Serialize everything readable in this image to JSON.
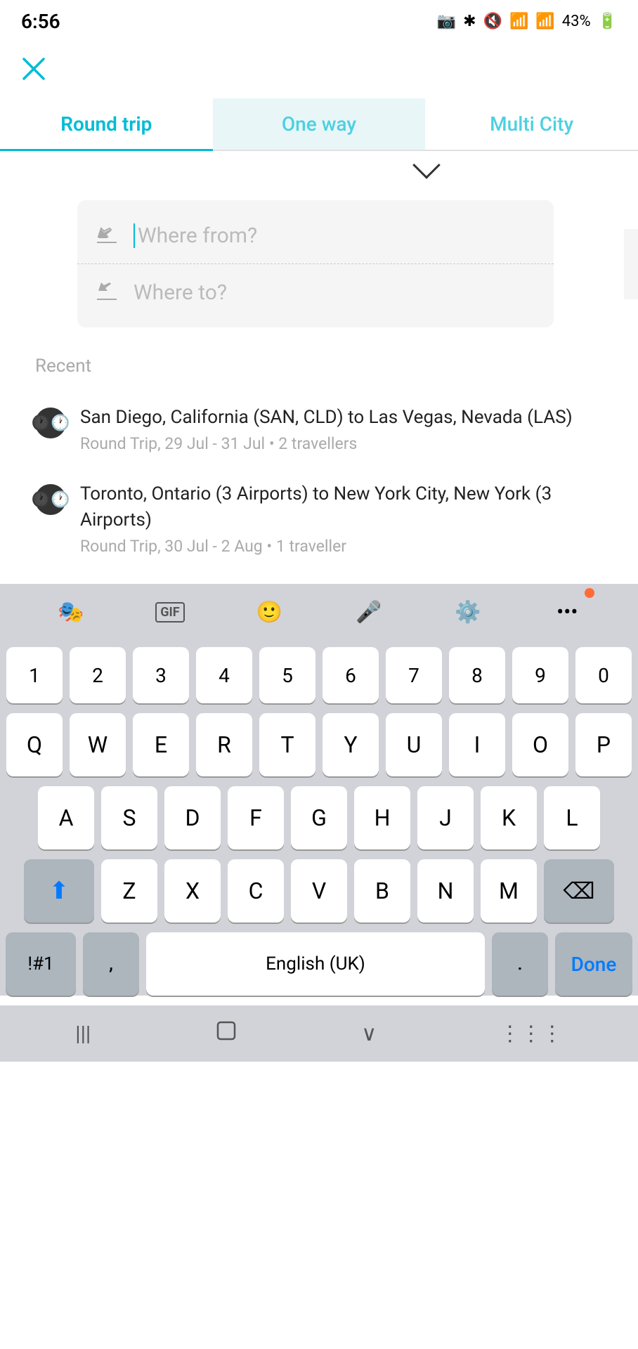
{
  "statusBar": {
    "time": "6:56",
    "battery": "43%"
  },
  "tabs": {
    "items": [
      {
        "id": "round-trip",
        "label": "Round trip",
        "active": true
      },
      {
        "id": "one-way",
        "label": "One way",
        "active": false
      },
      {
        "id": "multi-city",
        "label": "Multi City",
        "active": false
      }
    ]
  },
  "search": {
    "from_placeholder": "Where from?",
    "to_placeholder": "Where to?"
  },
  "recent": {
    "label": "Recent",
    "items": [
      {
        "route": "San Diego, California (SAN, CLD) to Las Vegas, Nevada (LAS)",
        "details": "Round Trip, 29 Jul - 31 Jul • 2 travellers"
      },
      {
        "route": "Toronto, Ontario (3 Airports) to New York City, New York (3 Airports)",
        "details": "Round Trip, 30 Jul - 2 Aug • 1 traveller"
      }
    ]
  },
  "keyboard": {
    "numbers": [
      "1",
      "2",
      "3",
      "4",
      "5",
      "6",
      "7",
      "8",
      "9",
      "0"
    ],
    "row1": [
      "Q",
      "W",
      "E",
      "R",
      "T",
      "Y",
      "U",
      "I",
      "O",
      "P"
    ],
    "row2": [
      "A",
      "S",
      "D",
      "F",
      "G",
      "H",
      "J",
      "K",
      "L"
    ],
    "row3": [
      "Z",
      "X",
      "C",
      "V",
      "B",
      "N",
      "M"
    ],
    "special_label": "!#1",
    "comma": ",",
    "space_label": "English (UK)",
    "period": ".",
    "done_label": "Done"
  },
  "navbar": {
    "back": "|||",
    "home": "□",
    "down": "∨",
    "grid": "⋮⋮⋮"
  }
}
